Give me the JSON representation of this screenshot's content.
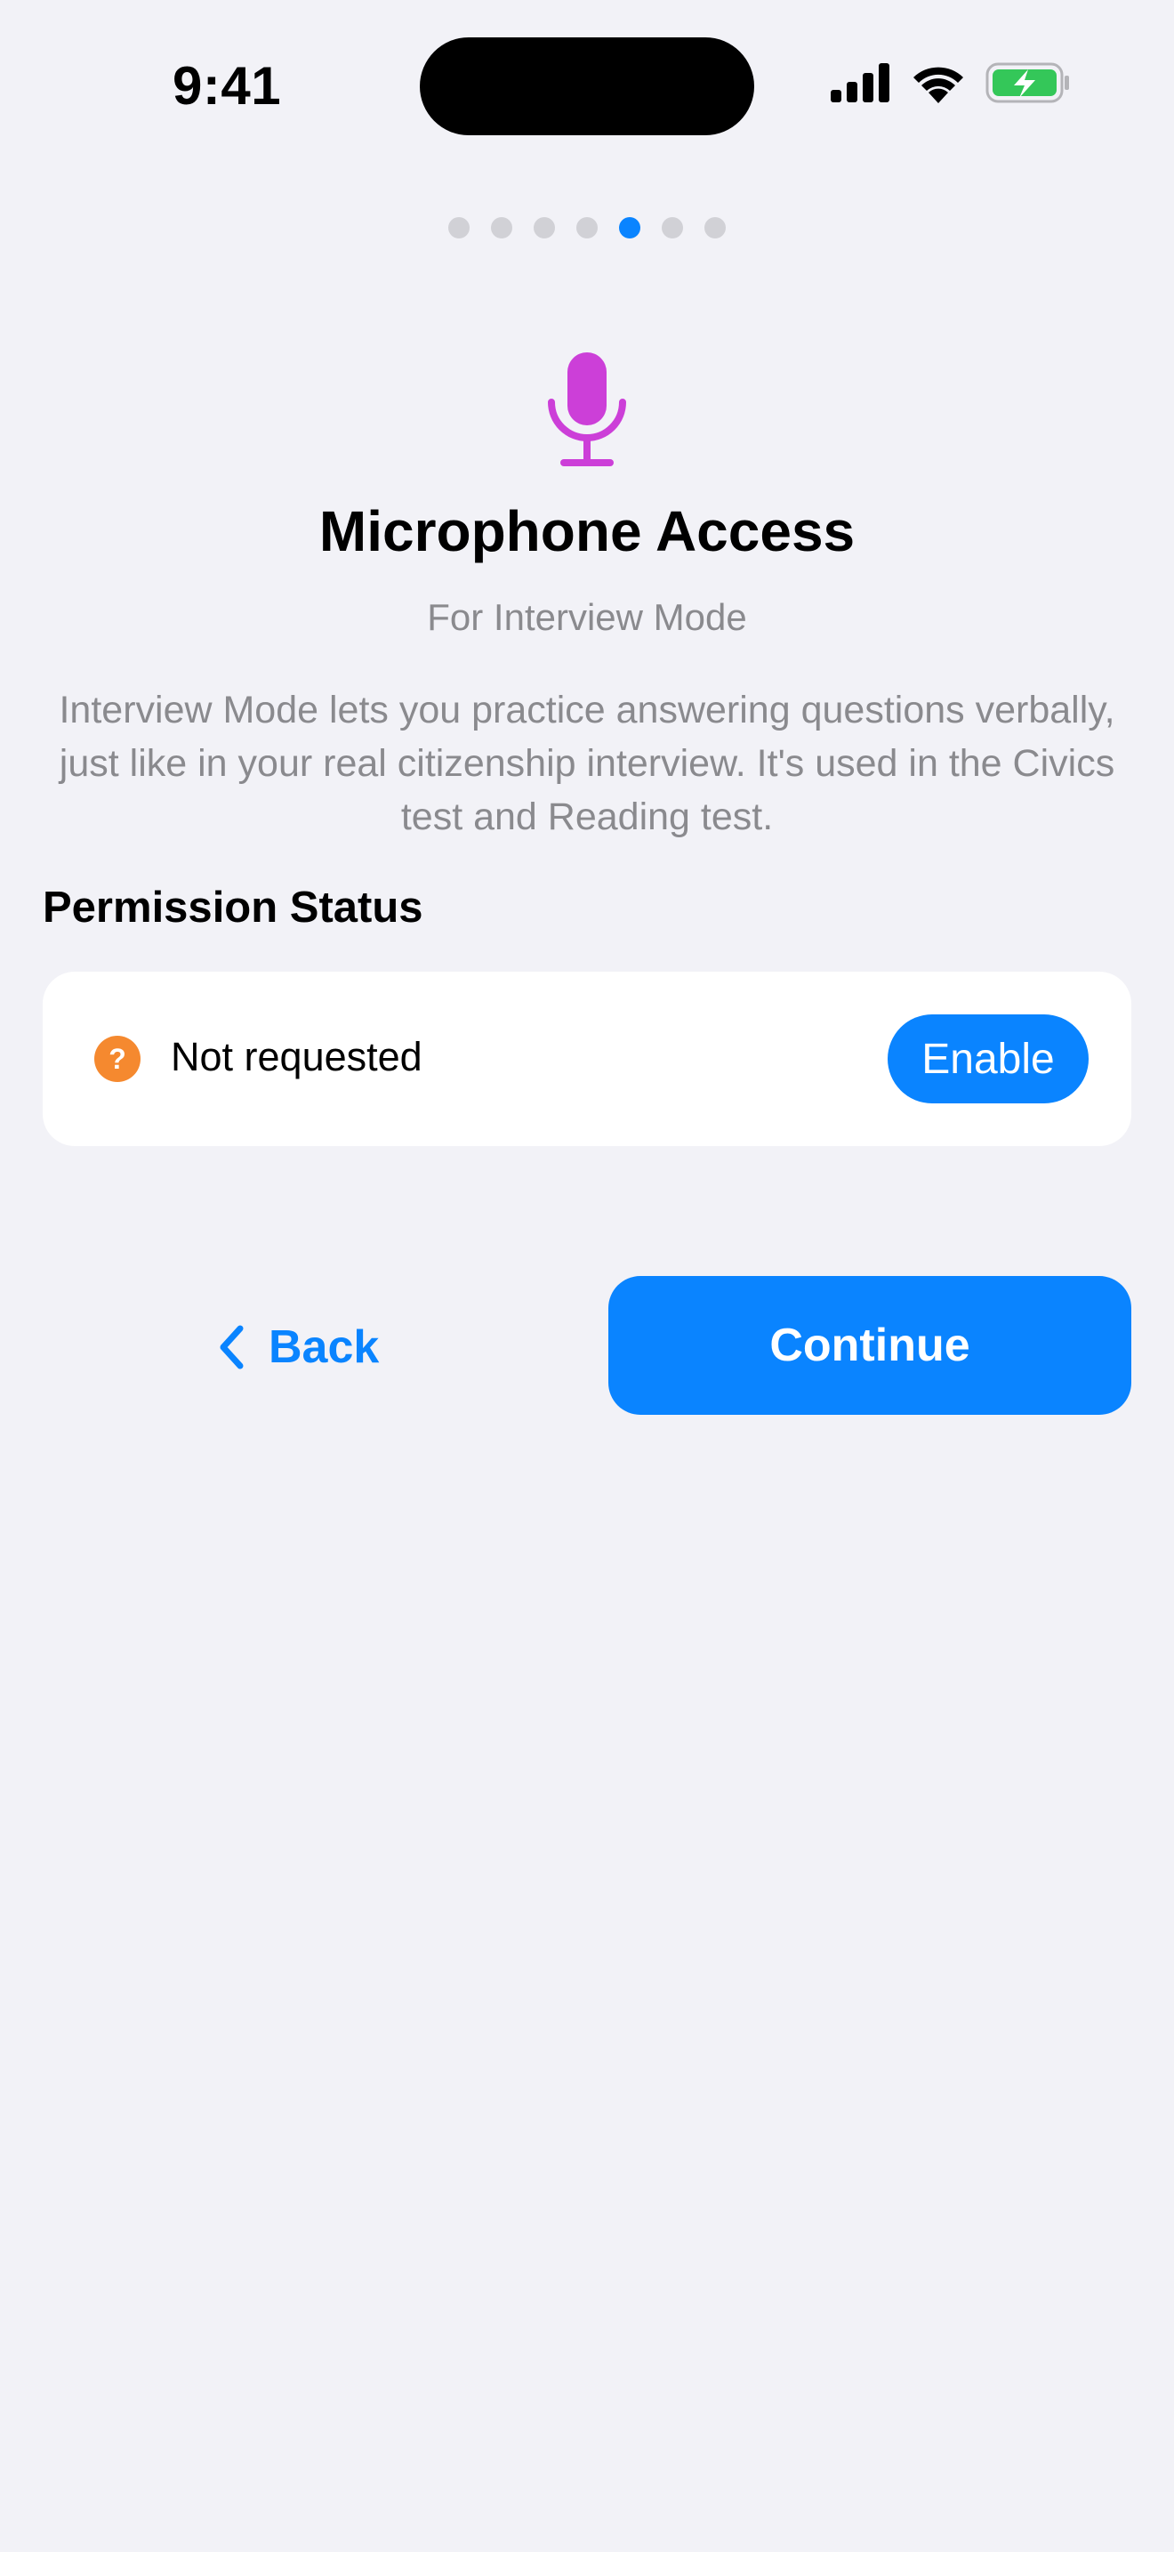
{
  "status_bar": {
    "time": "9:41",
    "icons": [
      "cellular-signal-icon",
      "wifi-icon",
      "battery-charging-icon"
    ]
  },
  "pager": {
    "total": 7,
    "active_index": 4
  },
  "hero": {
    "icon": "microphone-icon",
    "title": "Microphone Access",
    "subtitle": "For Interview Mode",
    "description": "Interview Mode lets you practice answering questions verbally, just like in your real citizenship interview. It's used in the Civics test and Reading test."
  },
  "permission": {
    "header": "Permission Status",
    "status_icon": "question-mark-icon",
    "status_icon_glyph": "?",
    "status_text": "Not requested",
    "enable_label": "Enable"
  },
  "navigation": {
    "back_label": "Back",
    "continue_label": "Continue"
  },
  "colors": {
    "accent": "#0a84ff",
    "mic": "#cc3fd8",
    "status_badge": "#f5892f",
    "background": "#f2f2f7",
    "battery_fill": "#34c759"
  }
}
